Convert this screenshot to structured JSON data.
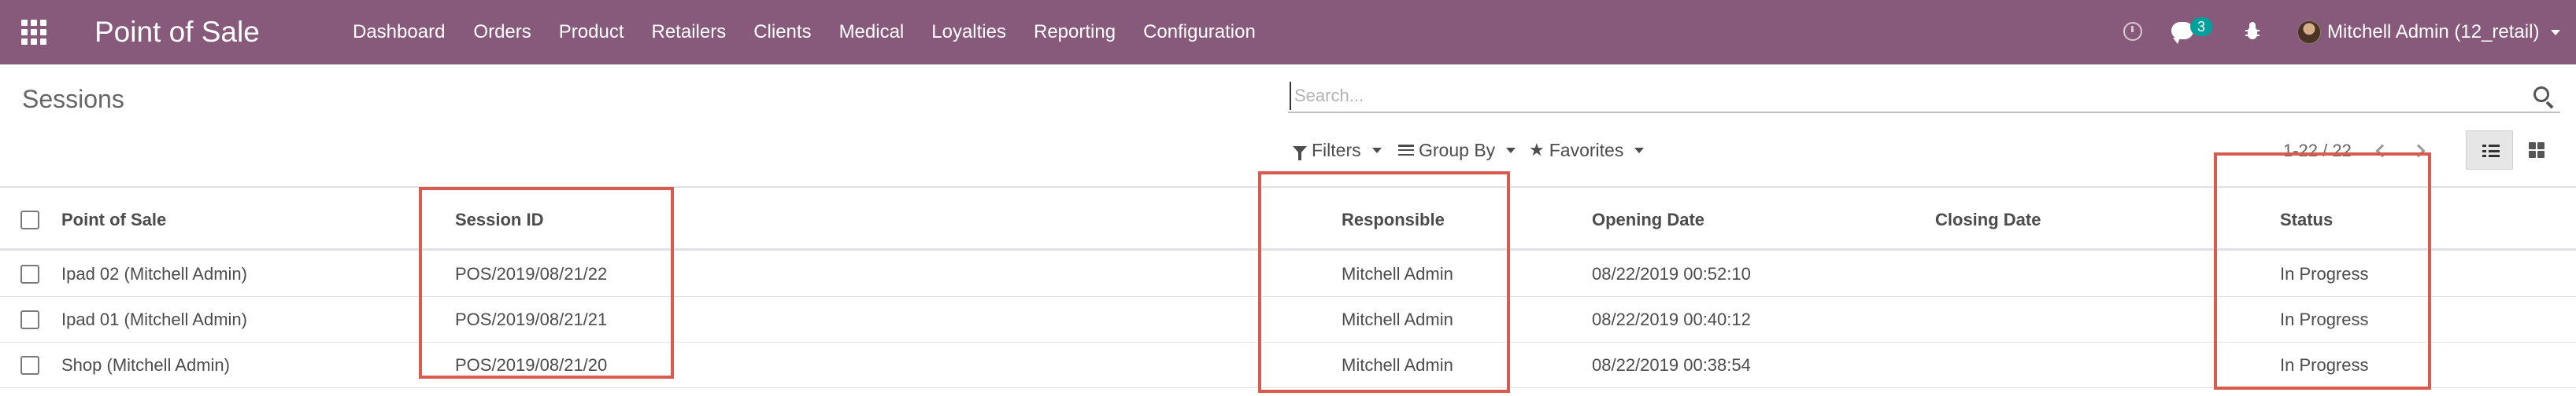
{
  "app": {
    "title": "Point of Sale",
    "menu": [
      "Dashboard",
      "Orders",
      "Product",
      "Retailers",
      "Clients",
      "Medical",
      "Loyalties",
      "Reporting",
      "Configuration"
    ],
    "chat_badge": "3",
    "user": "Mitchell Admin (12_retail)",
    "brand_color": "#875a7b",
    "accent_color": "#00a09d",
    "icons": {
      "apps": "apps-grid-icon",
      "clock": "clock-icon",
      "chat": "chat-icon",
      "bug": "bug-icon",
      "search": "search-icon",
      "list_view": "list-view-icon",
      "kanban_view": "kanban-view-icon"
    }
  },
  "control": {
    "breadcrumb": "Sessions",
    "search_placeholder": "Search...",
    "filters_label": "Filters",
    "groupby_label": "Group By",
    "favorites_label": "Favorites",
    "pager_value": "1-22 / 22"
  },
  "table": {
    "headers": {
      "pos": "Point of Sale",
      "session_id": "Session ID",
      "responsible": "Responsible",
      "opening_date": "Opening Date",
      "closing_date": "Closing Date",
      "status": "Status"
    },
    "rows": [
      {
        "pos": "Ipad 02 (Mitchell Admin)",
        "session_id": "POS/2019/08/21/22",
        "responsible": "Mitchell Admin",
        "opening_date": "08/22/2019 00:52:10",
        "closing_date": "",
        "status": "In Progress"
      },
      {
        "pos": "Ipad 01 (Mitchell Admin)",
        "session_id": "POS/2019/08/21/21",
        "responsible": "Mitchell Admin",
        "opening_date": "08/22/2019 00:40:12",
        "closing_date": "",
        "status": "In Progress"
      },
      {
        "pos": "Shop (Mitchell Admin)",
        "session_id": "POS/2019/08/21/20",
        "responsible": "Mitchell Admin",
        "opening_date": "08/22/2019 00:38:54",
        "closing_date": "",
        "status": "In Progress"
      }
    ]
  },
  "highlight_color": "#d95b4f"
}
